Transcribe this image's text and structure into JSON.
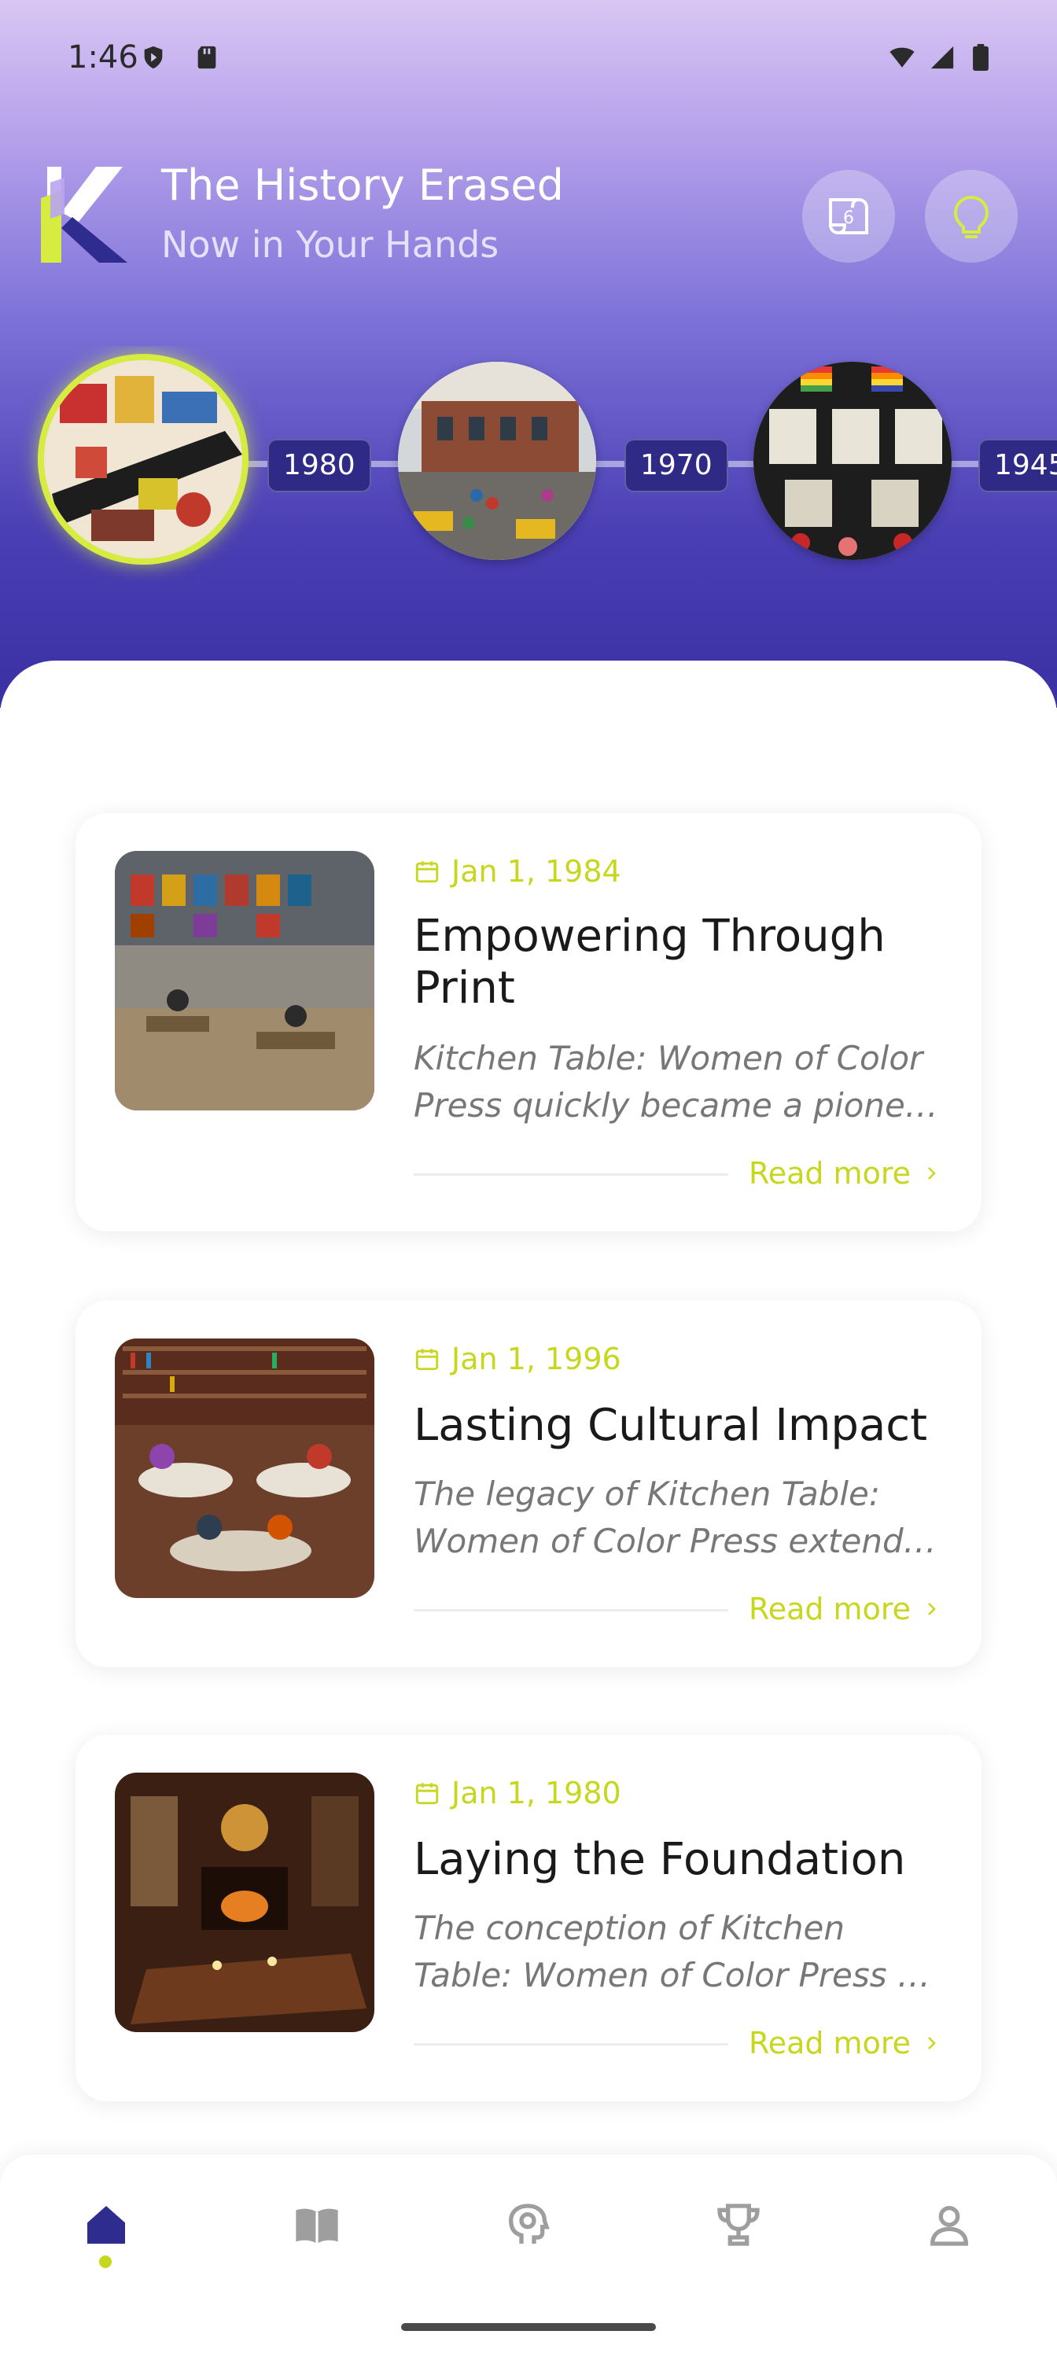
{
  "status_bar": {
    "time": "1:46"
  },
  "header": {
    "title": "The History Erased",
    "subtitle": "Now in Your Hands",
    "scroll_badge_count": "6"
  },
  "timeline": {
    "years": [
      "1980",
      "1970",
      "1945"
    ],
    "thumbnails": [
      "collage-poster",
      "city-street-crowd",
      "rainbow-flag-memorial"
    ]
  },
  "cards": [
    {
      "date": "Jan 1, 1984",
      "title": "Empowering Through Print",
      "excerpt": "Kitchen Table: Women of Color Press quickly became a pione…",
      "read_more": "Read more"
    },
    {
      "date": "Jan 1, 1996",
      "title": "Lasting Cultural Impact",
      "excerpt": "The legacy of Kitchen Table: Women of Color Press extend…",
      "read_more": "Read more"
    },
    {
      "date": "Jan 1, 1980",
      "title": "Laying the Foundation",
      "excerpt": "The conception of Kitchen Table: Women of Color Press …",
      "read_more": "Read more"
    }
  ],
  "bottom_nav": {
    "items": [
      "home-icon",
      "book-icon",
      "brain-icon",
      "trophy-icon",
      "profile-icon"
    ],
    "active": "home-icon"
  },
  "colors": {
    "accent": "#c6d71e",
    "primary": "#2e2d8f",
    "hero_top": "#d9c6f3",
    "hero_bottom": "#3a2fa3"
  }
}
